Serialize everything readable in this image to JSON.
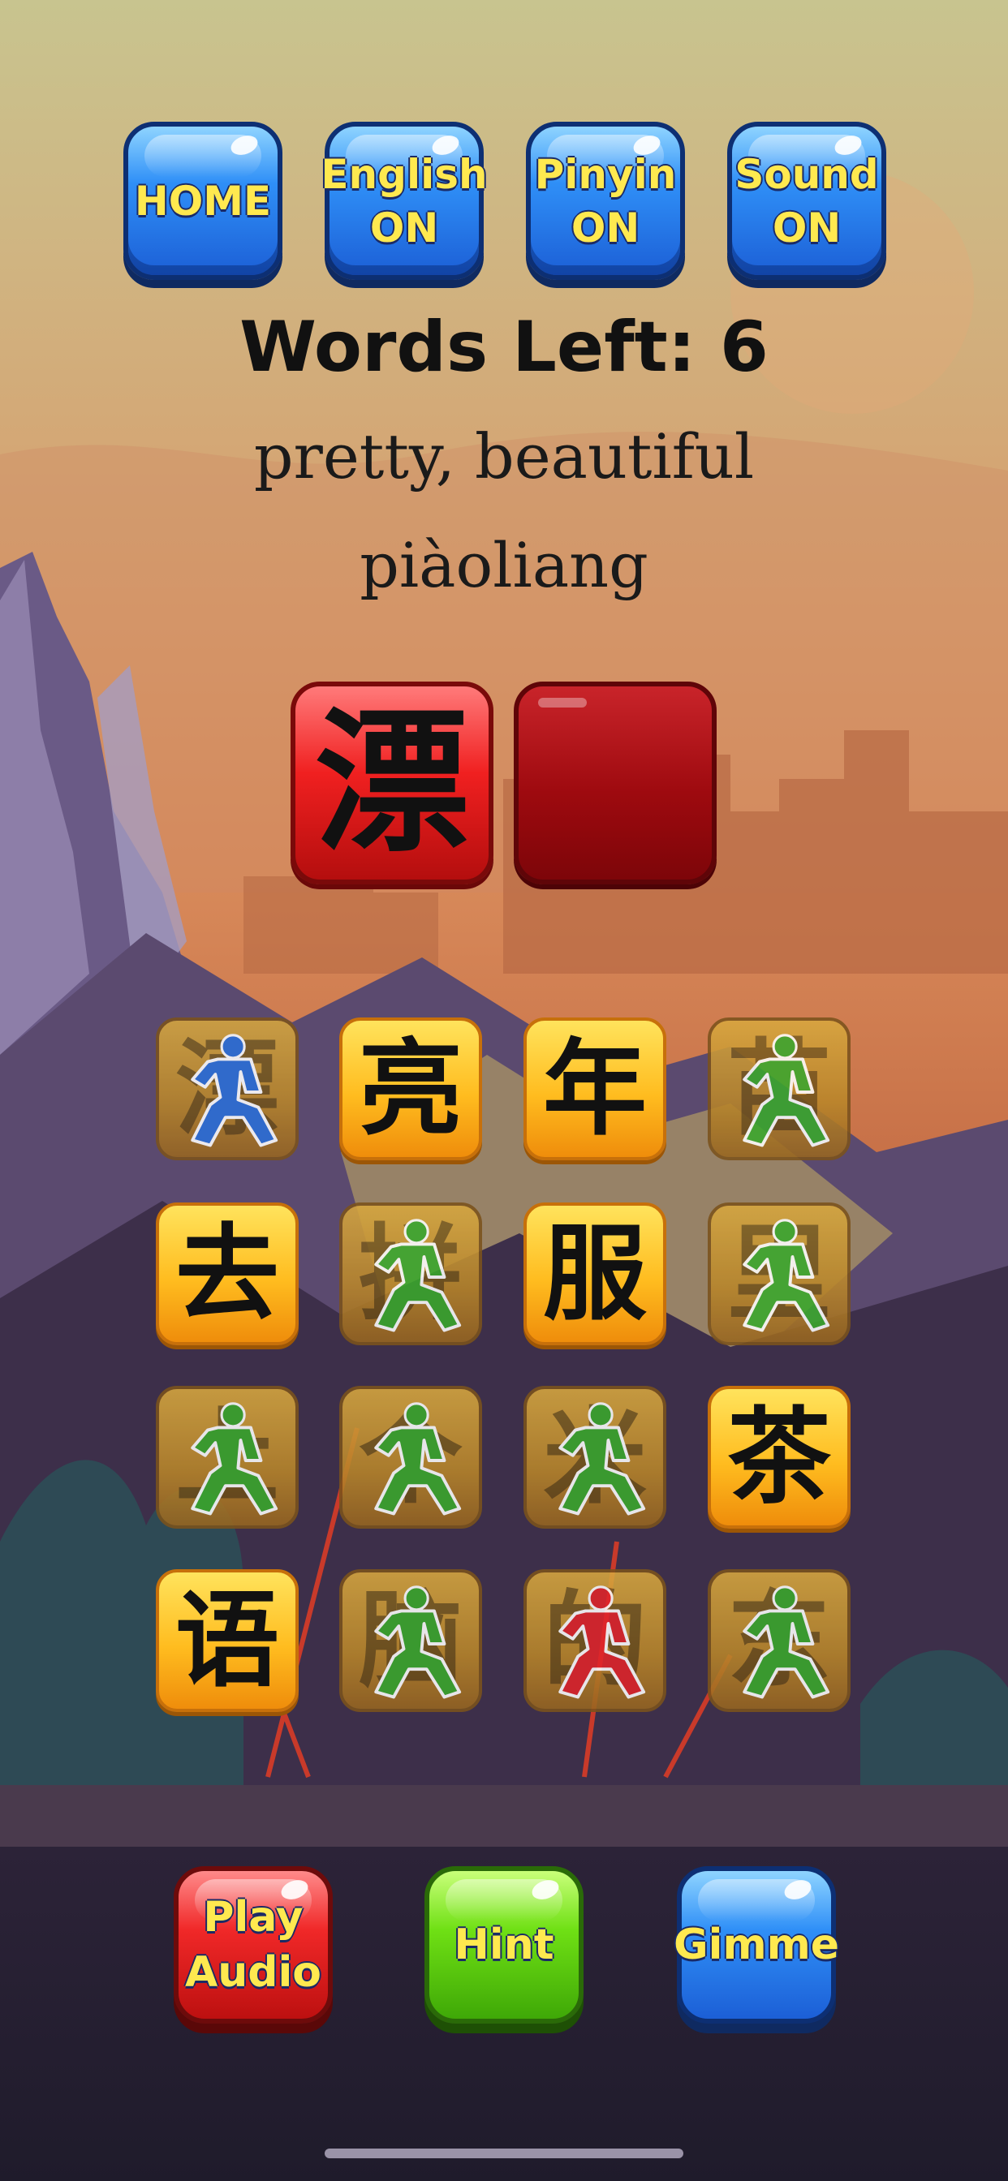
{
  "top_buttons": {
    "home": "HOME",
    "english": "English\nON",
    "pinyin": "Pinyin\nON",
    "sound": "Sound\nON"
  },
  "status": {
    "words_left": "Words Left: 6"
  },
  "prompt": {
    "english": "pretty, beautiful",
    "pinyin": "piàoliang"
  },
  "answer": {
    "slots": [
      "漂",
      ""
    ]
  },
  "tiles": [
    {
      "char": "漂",
      "state": "used",
      "fighter": "blue"
    },
    {
      "char": "亮",
      "state": "open",
      "fighter": ""
    },
    {
      "char": "年",
      "state": "open",
      "fighter": ""
    },
    {
      "char": "苗",
      "state": "used",
      "fighter": "green"
    },
    {
      "char": "去",
      "state": "open",
      "fighter": ""
    },
    {
      "char": "拼",
      "state": "used",
      "fighter": "green"
    },
    {
      "char": "服",
      "state": "open",
      "fighter": ""
    },
    {
      "char": "里",
      "state": "used",
      "fighter": "green"
    },
    {
      "char": "上",
      "state": "used",
      "fighter": "green"
    },
    {
      "char": "个",
      "state": "used",
      "fighter": "green"
    },
    {
      "char": "米",
      "state": "used",
      "fighter": "green"
    },
    {
      "char": "茶",
      "state": "open",
      "fighter": ""
    },
    {
      "char": "语",
      "state": "open",
      "fighter": ""
    },
    {
      "char": "脑",
      "state": "used",
      "fighter": "green"
    },
    {
      "char": "的",
      "state": "used",
      "fighter": "red"
    },
    {
      "char": "东",
      "state": "used",
      "fighter": "green"
    }
  ],
  "bottom_buttons": {
    "play_audio": "Play\nAudio",
    "hint": "Hint",
    "gimme": "Gimme"
  },
  "colors": {
    "fighter_blue": "#2b6fd8",
    "fighter_green": "#3aa82c",
    "fighter_red": "#e0242a",
    "button_text": "#ffe94f"
  }
}
